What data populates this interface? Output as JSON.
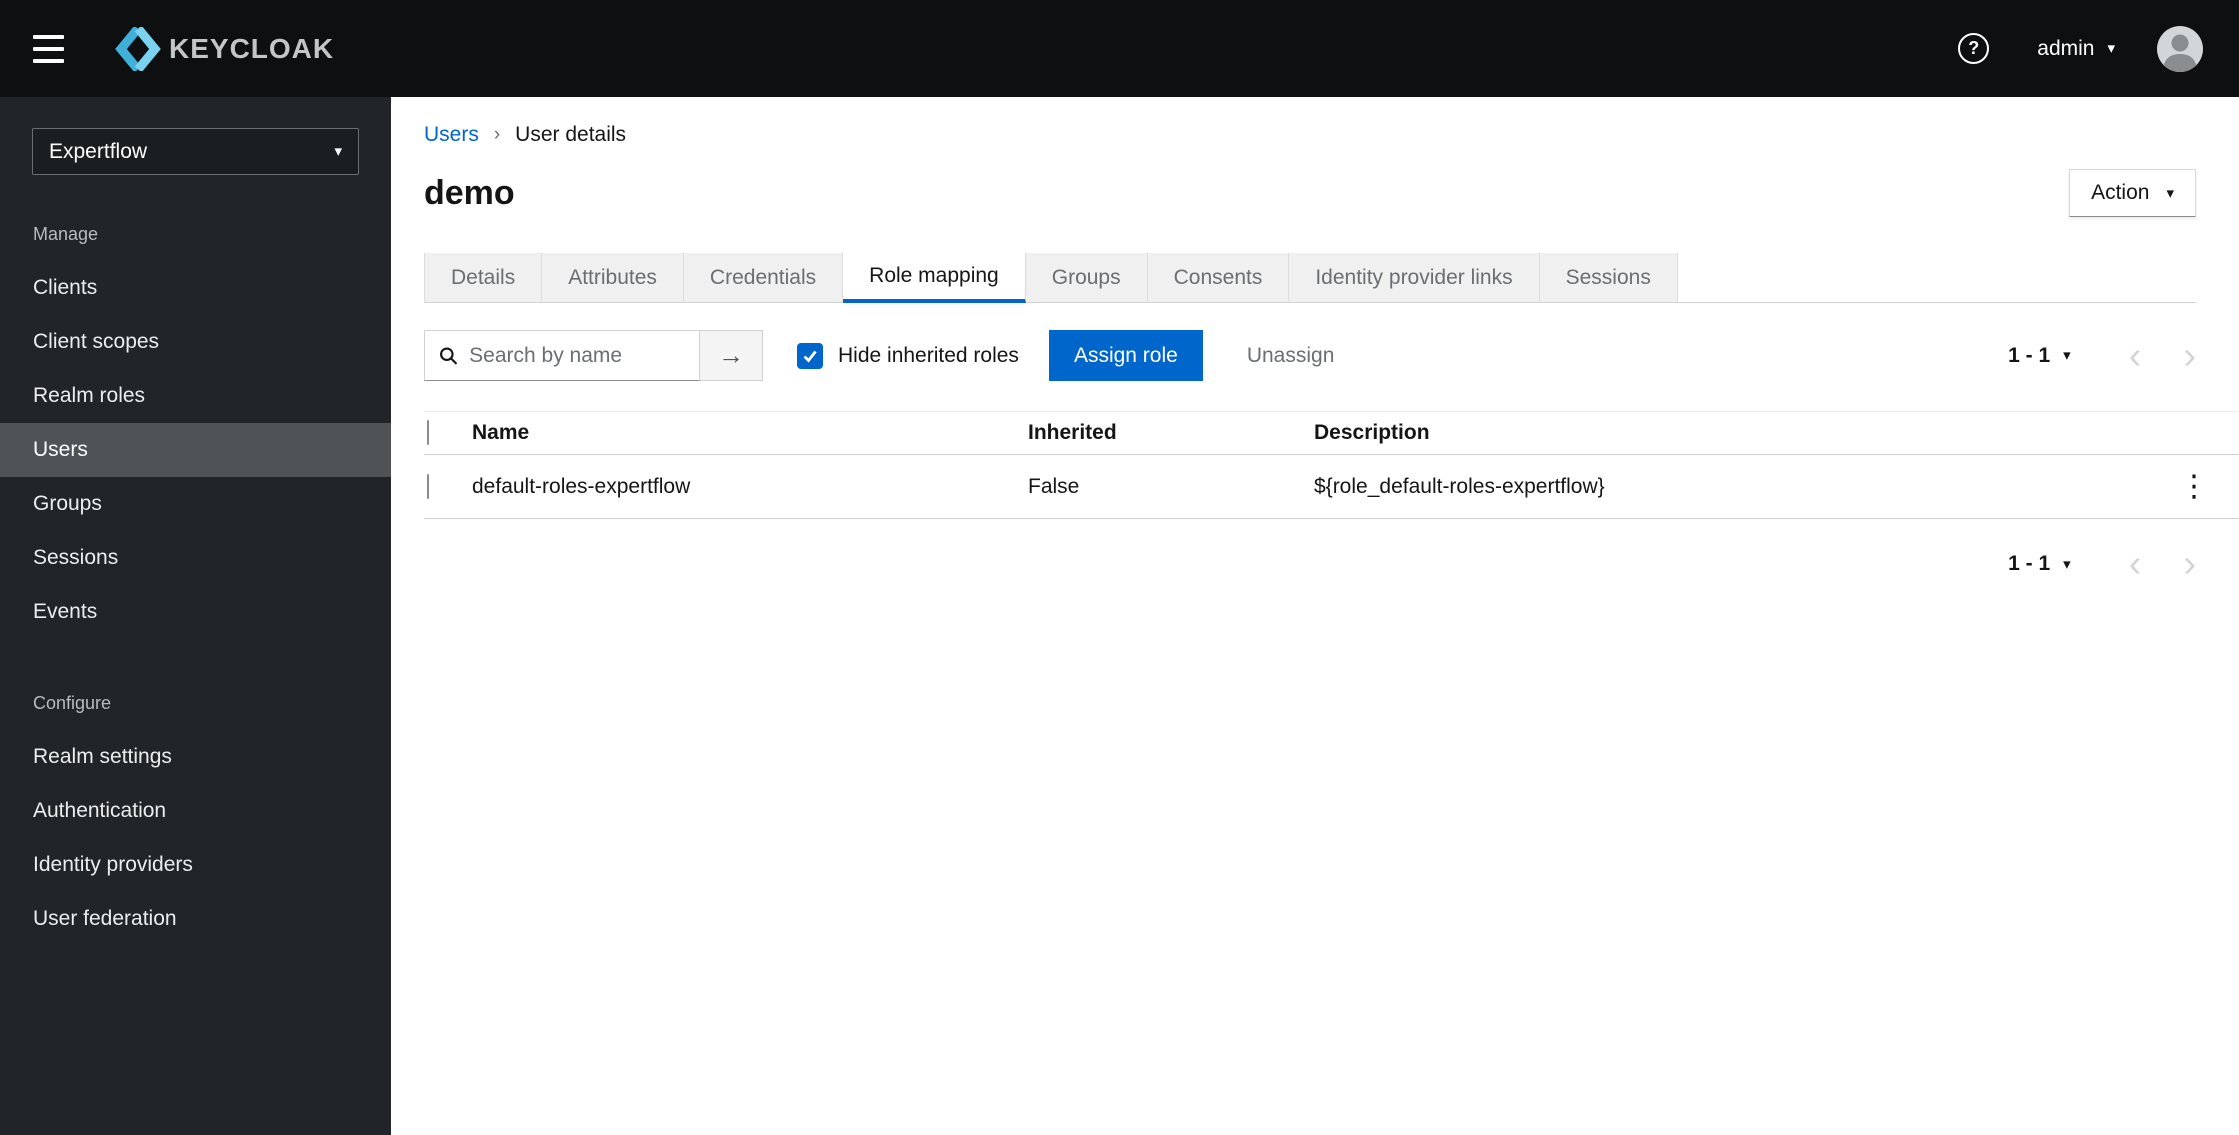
{
  "icons": {
    "help": "?",
    "caret": "▾",
    "breadcrumb_sep": "›",
    "chevron_left": "‹",
    "chevron_right": "›",
    "arrow_right": "→",
    "kebab": "⋮"
  },
  "topbar": {
    "brand": "KEYCLOAK",
    "username": "admin"
  },
  "sidebar": {
    "realm": "Expertflow",
    "sections": [
      {
        "label": "Manage",
        "items": [
          "Clients",
          "Client scopes",
          "Realm roles",
          "Users",
          "Groups",
          "Sessions",
          "Events"
        ]
      },
      {
        "label": "Configure",
        "items": [
          "Realm settings",
          "Authentication",
          "Identity providers",
          "User federation"
        ]
      }
    ]
  },
  "breadcrumb": {
    "parent": "Users",
    "current": "User details"
  },
  "page": {
    "title": "demo",
    "action": "Action"
  },
  "tabs": [
    "Details",
    "Attributes",
    "Credentials",
    "Role mapping",
    "Groups",
    "Consents",
    "Identity provider links",
    "Sessions"
  ],
  "active_tab": "Role mapping",
  "toolbar": {
    "search_placeholder": "Search by name",
    "hide_inherited_label": "Hide inherited roles",
    "hide_inherited_checked": true,
    "assign_role": "Assign role",
    "unassign": "Unassign",
    "pagination": "1 - 1"
  },
  "table": {
    "headers": {
      "name": "Name",
      "inherited": "Inherited",
      "description": "Description"
    },
    "rows": [
      {
        "name": "default-roles-expertflow",
        "inherited": "False",
        "description": "${role_default-roles-expertflow}"
      }
    ]
  },
  "footer": {
    "pagination": "1 - 1"
  },
  "colors": {
    "accent": "#0066cc",
    "topbar_bg": "#0d0f11",
    "sidebar_bg": "#212428",
    "link": "#0066cc"
  }
}
